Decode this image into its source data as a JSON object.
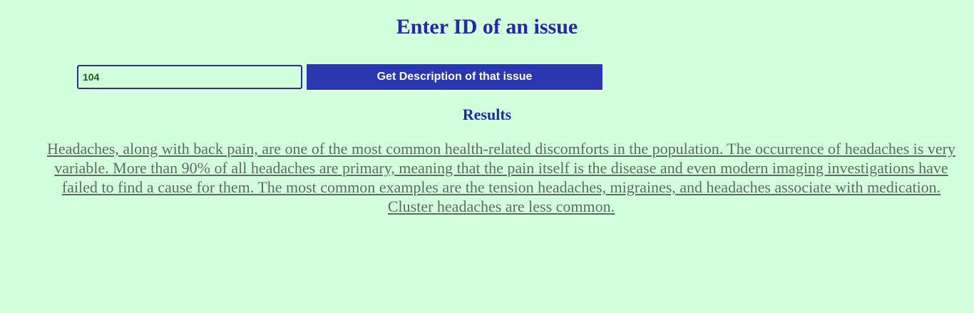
{
  "header": {
    "title": "Enter ID of an issue"
  },
  "form": {
    "issue_id_value": "104",
    "submit_label": "Get Description of that issue"
  },
  "results": {
    "heading": "Results",
    "description": "Headaches, along with back pain, are one of the most common health-related discomforts in the population. The occurrence of headaches is very variable. More than 90% of all headaches are primary, meaning that the pain itself is the disease and even modern imaging investigations have failed to find a cause for them. The most common examples are the tension headaches, migraines, and headaches associate with medication. Cluster headaches are less common."
  },
  "colors": {
    "background": "#d2ffdc",
    "heading": "#2626a8",
    "button": "#2b37b0",
    "result_text": "#5e6b64"
  }
}
